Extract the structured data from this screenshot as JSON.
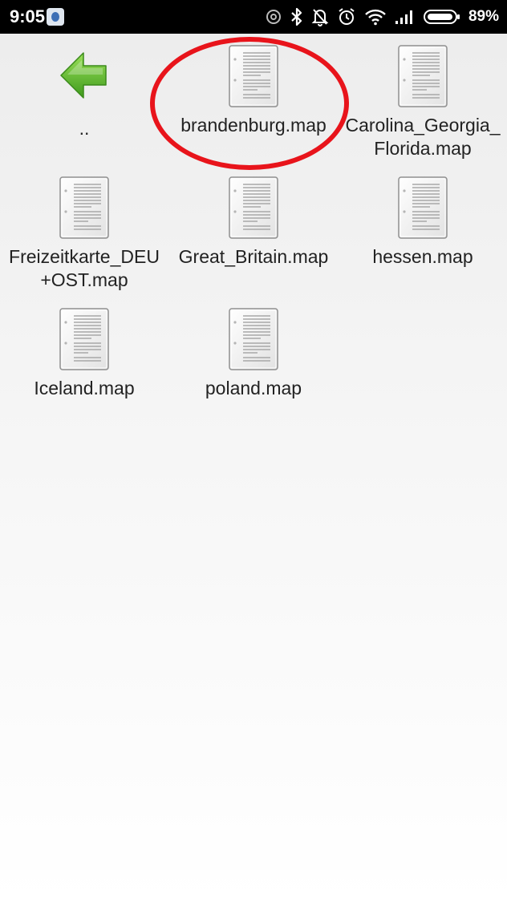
{
  "status_bar": {
    "time": "9:05",
    "battery_percent": "89%",
    "icons": [
      "app-notification-icon",
      "sync-icon",
      "bluetooth-icon",
      "notifications-off-icon",
      "alarm-icon",
      "wifi-icon",
      "signal-icon",
      "battery-icon"
    ]
  },
  "colors": {
    "highlight": "#e8141b",
    "back_arrow": "#5db52a",
    "text": "#222222"
  },
  "files": [
    {
      "label": "..",
      "icon": "back-arrow-icon"
    },
    {
      "label": "brandenburg.map",
      "icon": "document-icon",
      "highlighted": true
    },
    {
      "label": "Carolina_Georgia_",
      "label2": "Florida.map",
      "icon": "document-icon"
    },
    {
      "label": "Freizeitkarte_DEU",
      "label2": "+OST.map",
      "icon": "document-icon"
    },
    {
      "label": "Great_Britain.map",
      "icon": "document-icon"
    },
    {
      "label": "hessen.map",
      "icon": "document-icon"
    },
    {
      "label": "Iceland.map",
      "icon": "document-icon"
    },
    {
      "label": "poland.map",
      "icon": "document-icon"
    }
  ]
}
